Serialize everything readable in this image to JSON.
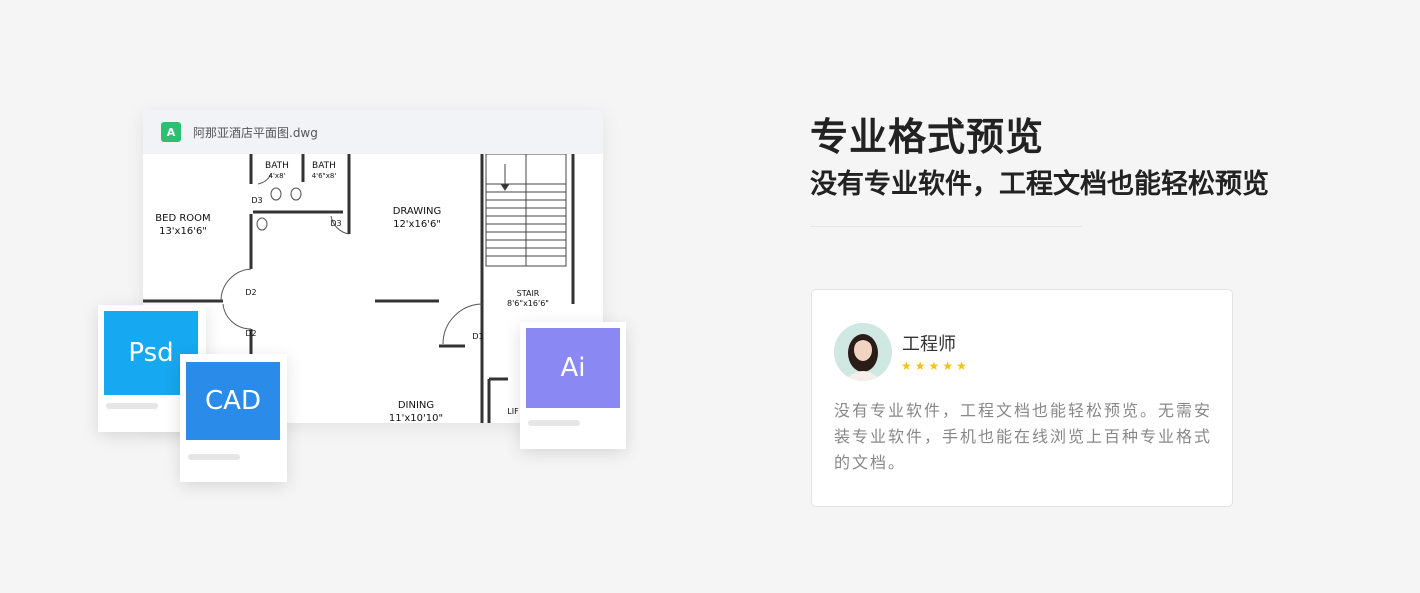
{
  "preview": {
    "file_icon_label": "A",
    "file_name": "阿那亚酒店平面图.dwg",
    "plan_labels": {
      "bath1": "BATH",
      "bath1_size": "4'x8'",
      "bath2": "BATH",
      "bath2_size": "4'6\"x8'",
      "bedroom": "BED ROOM",
      "bedroom_size": "13'x16'6\"",
      "drawing": "DRAWING",
      "drawing_size": "12'x16'6\"",
      "stair": "STAIR",
      "stair_size": "8'6\"x16'6\"",
      "dining": "DINING",
      "dining_size": "11'x10'10\"",
      "lift": "LIF",
      "d3a": "D3",
      "d3b": "D3",
      "d2a": "D2",
      "d2b": "D2",
      "d1": "D1"
    }
  },
  "format_cards": {
    "psd": "Psd",
    "cad": "CAD",
    "ai": "Ai"
  },
  "headline": "专业格式预览",
  "subheadline": "没有专业软件，工程文档也能轻松预览",
  "review": {
    "name": "工程师",
    "stars": [
      "★",
      "★",
      "★",
      "★",
      "★"
    ],
    "text": "没有专业软件，工程文档也能轻松预览。无需安装专业软件，手机也能在线浏览上百种专业格式的文档。"
  },
  "colors": {
    "psd": "#16a8f0",
    "cad": "#2a8be8",
    "ai": "#8a88f3",
    "star": "#f3c315",
    "file_icon": "#2fbf71"
  }
}
